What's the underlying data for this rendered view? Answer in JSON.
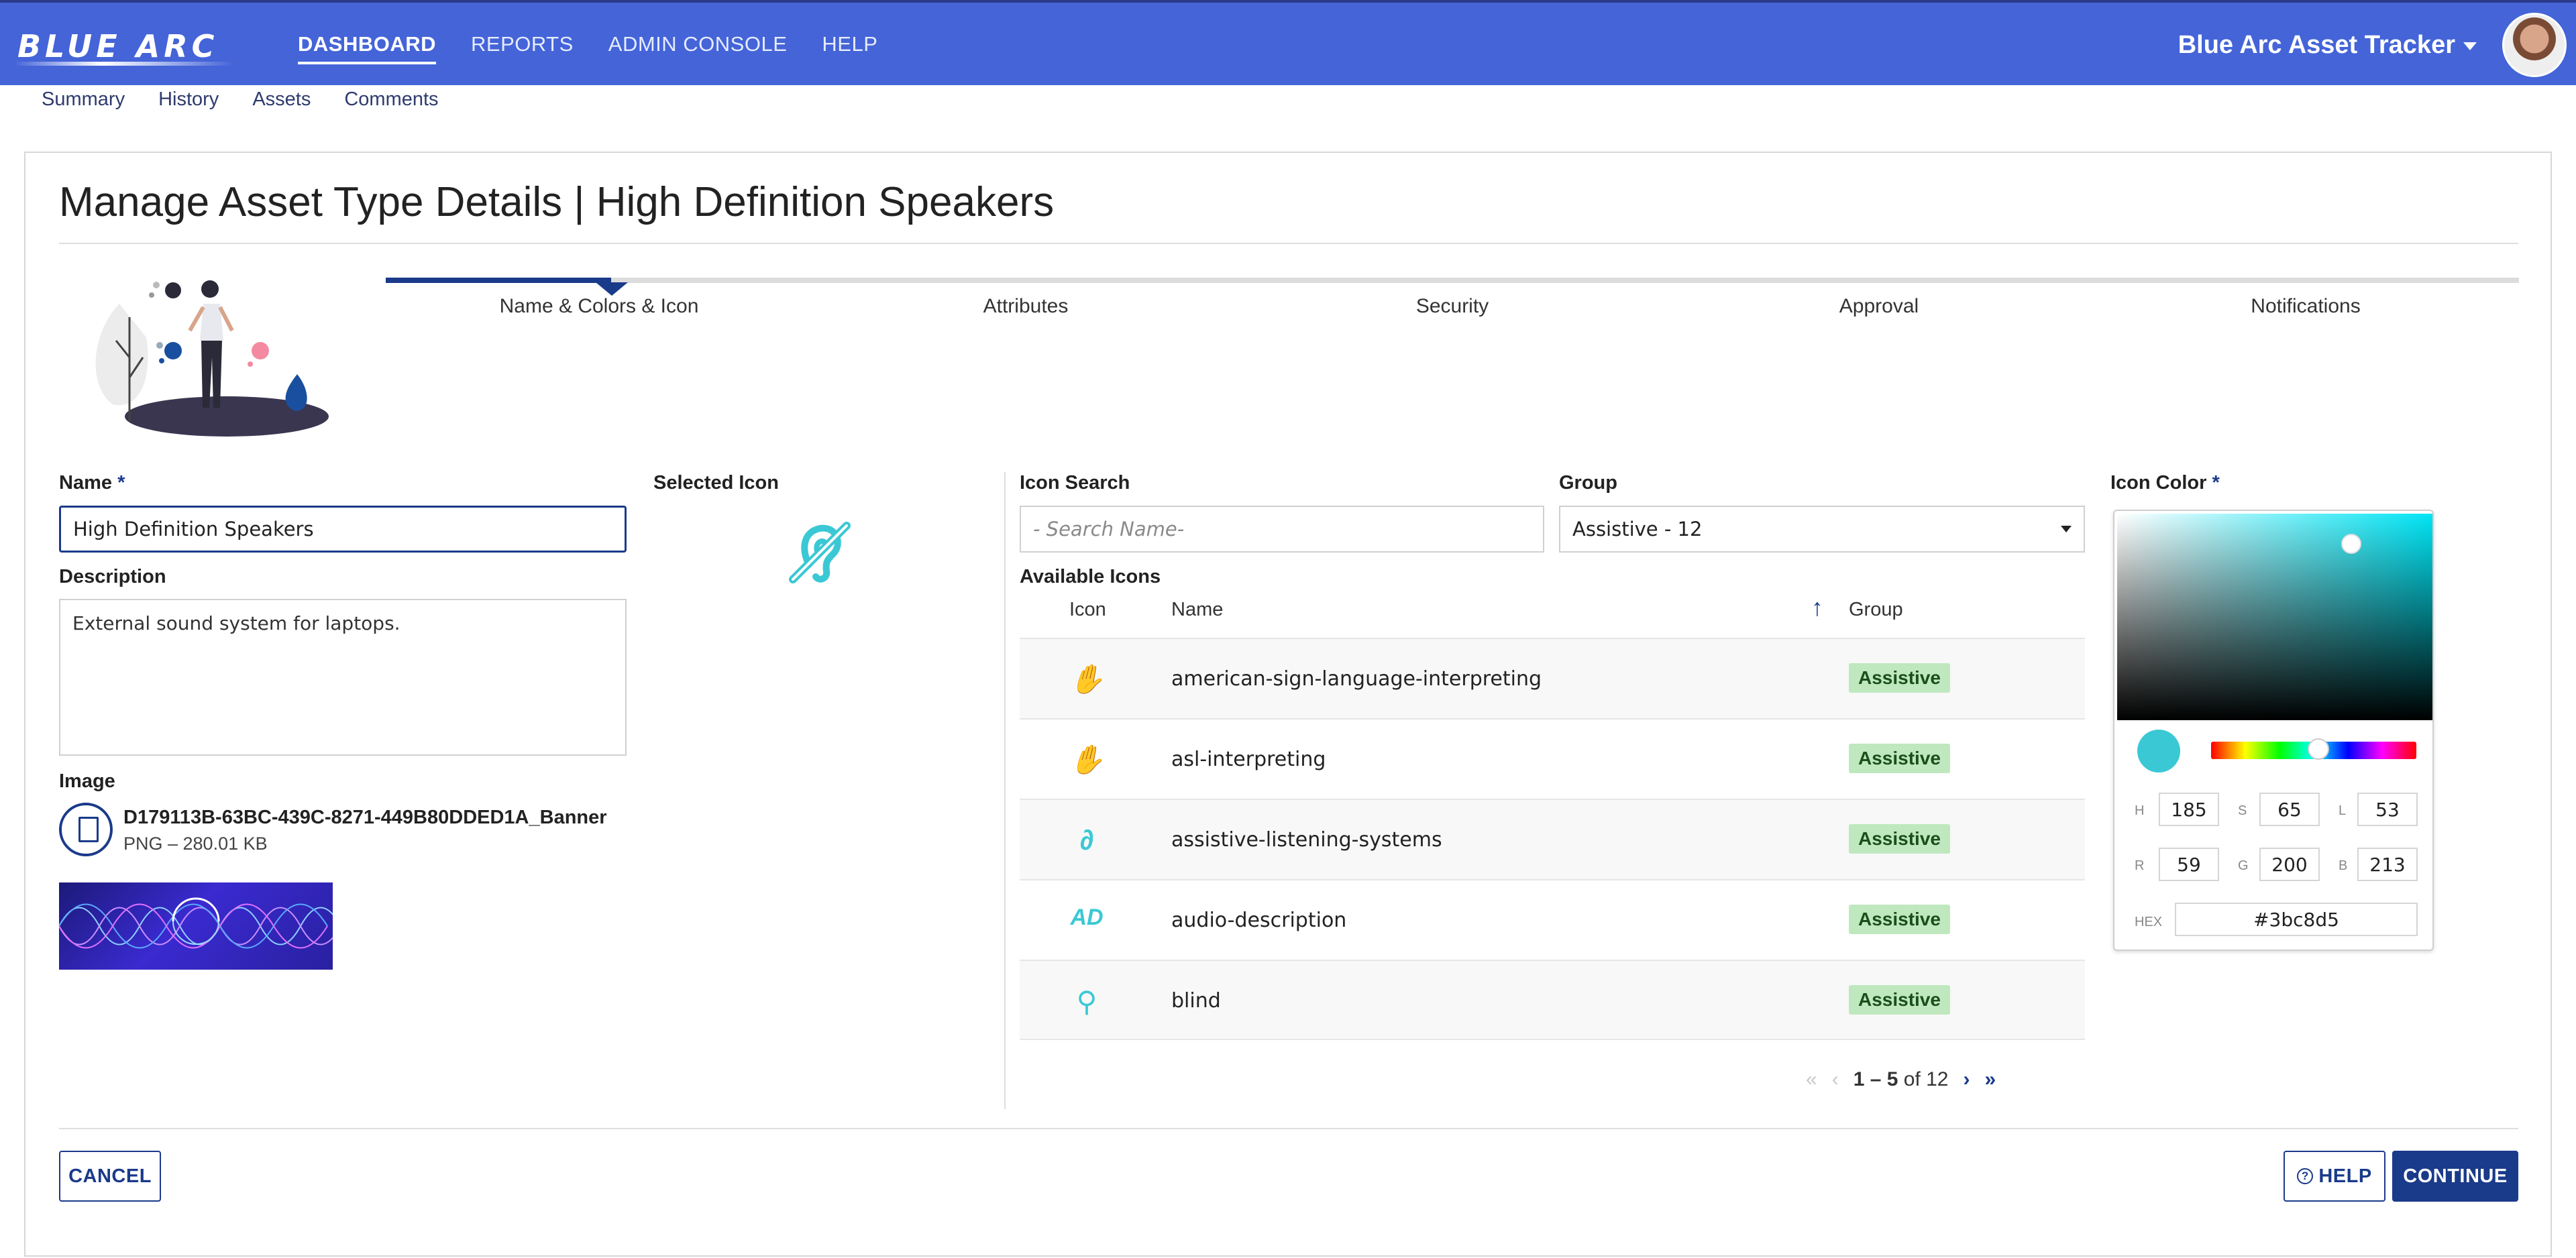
{
  "header": {
    "logo": "BLUE ARC",
    "nav": [
      "DASHBOARD",
      "REPORTS",
      "ADMIN CONSOLE",
      "HELP"
    ],
    "app_title": "Blue Arc Asset Tracker"
  },
  "subnav": [
    "Summary",
    "History",
    "Assets",
    "Comments"
  ],
  "page": {
    "title": "Manage Asset Type Details | High Definition Speakers"
  },
  "steps": [
    "Name & Colors & Icon",
    "Attributes",
    "Security",
    "Approval",
    "Notifications"
  ],
  "form": {
    "name_label": "Name",
    "name_value": "High Definition Speakers",
    "description_label": "Description",
    "description_value": "External sound system for laptops.",
    "image_label": "Image",
    "file_name": "D179113B-63BC-439C-8271-449B80DDED1A_Banner",
    "file_meta": "PNG – 280.01 KB",
    "selected_icon_label": "Selected Icon",
    "required_mark": "*"
  },
  "icon_search": {
    "label": "Icon Search",
    "placeholder": "- Search Name-",
    "group_label": "Group",
    "group_value": "Assistive - 12",
    "available_label": "Available Icons",
    "columns": {
      "icon": "Icon",
      "name": "Name",
      "group": "Group"
    },
    "sort_glyph": "↑",
    "rows": [
      {
        "name": "american-sign-language-interpreting",
        "group": "Assistive",
        "glyph": "✋"
      },
      {
        "name": "asl-interpreting",
        "group": "Assistive",
        "glyph": "✋"
      },
      {
        "name": "assistive-listening-systems",
        "group": "Assistive",
        "glyph": "∂"
      },
      {
        "name": "audio-description",
        "group": "Assistive",
        "glyph": "AD"
      },
      {
        "name": "blind",
        "group": "Assistive",
        "glyph": "⚲"
      }
    ],
    "pager": {
      "range": "1 – 5",
      "of_text": "of 12"
    }
  },
  "icon_color": {
    "label": "Icon Color",
    "h": "185",
    "s": "65",
    "l": "53",
    "r": "59",
    "g": "200",
    "b": "213",
    "hex": "#3bc8d5",
    "field_labels": {
      "h": "H",
      "s": "S",
      "l": "L",
      "r": "R",
      "g": "G",
      "b": "B",
      "hex": "HEX"
    }
  },
  "buttons": {
    "cancel": "CANCEL",
    "help": "HELP",
    "continue": "CONTINUE"
  },
  "colors": {
    "accent": "#1a3a8a",
    "topbar": "#4464d8",
    "icon": "#3bc8d5",
    "badge": "#bfe8bf"
  }
}
